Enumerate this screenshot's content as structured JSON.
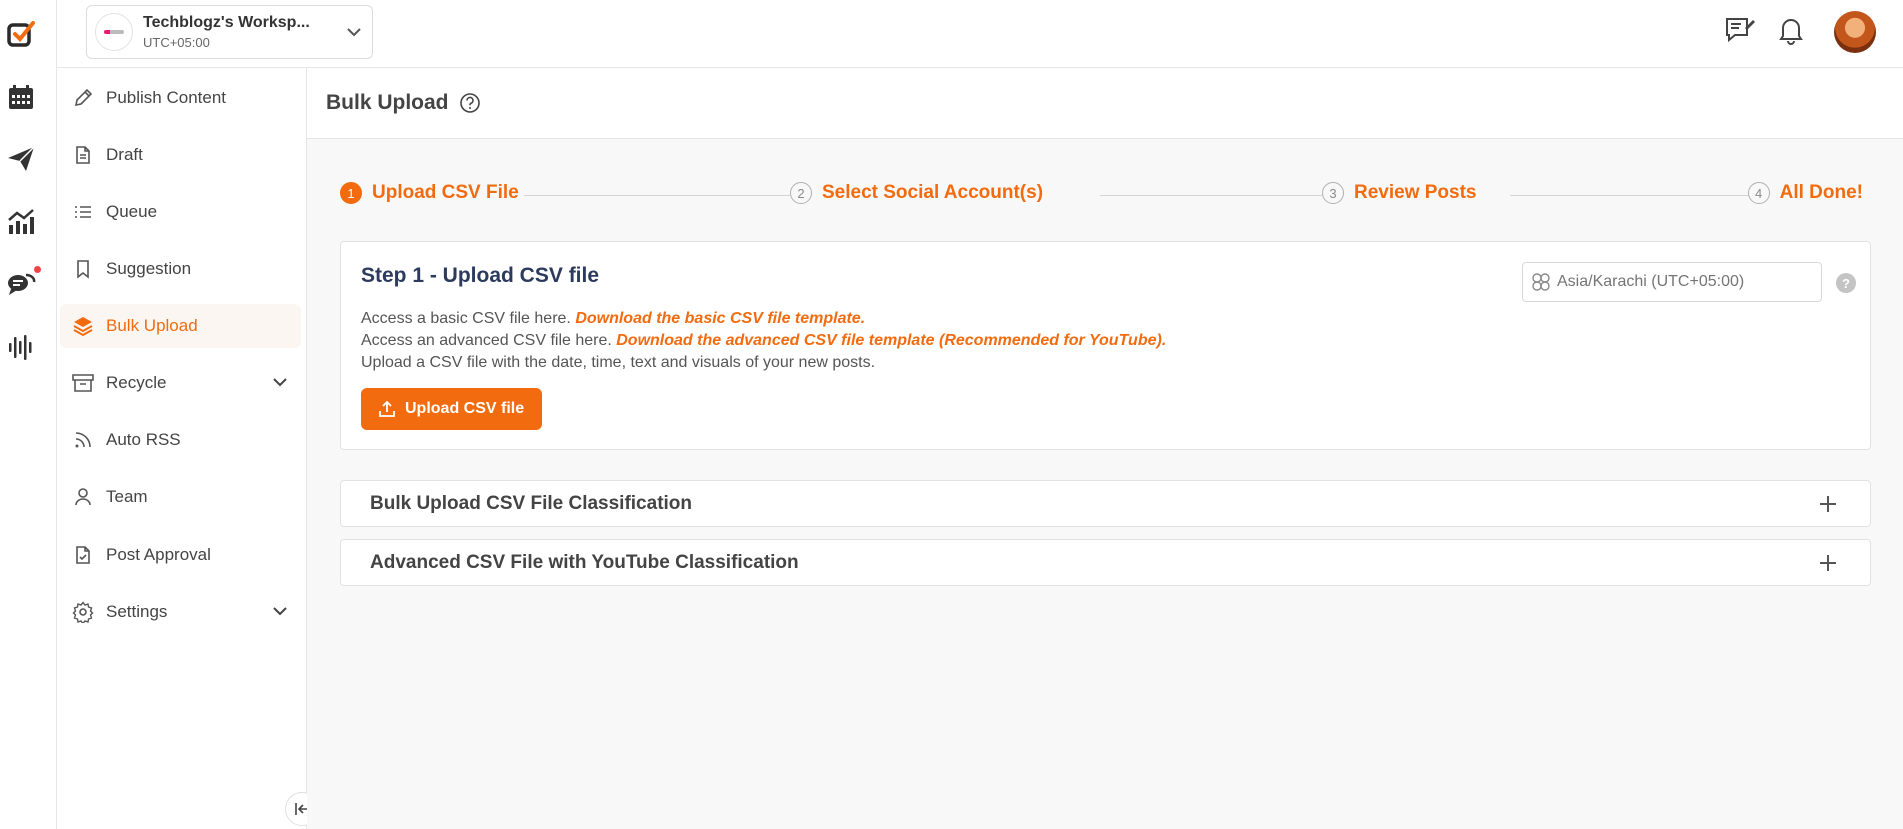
{
  "workspace": {
    "name": "Techblogz's Worksp...",
    "timezone": "UTC+05:00"
  },
  "sidebar": {
    "items": [
      {
        "label": "Publish Content",
        "icon": "pen-icon"
      },
      {
        "label": "Draft",
        "icon": "document-icon"
      },
      {
        "label": "Queue",
        "icon": "list-icon"
      },
      {
        "label": "Suggestion",
        "icon": "bookmark-icon"
      },
      {
        "label": "Bulk Upload",
        "icon": "layers-icon",
        "active": true
      },
      {
        "label": "Recycle",
        "icon": "archive-icon",
        "expandable": true
      },
      {
        "label": "Auto RSS",
        "icon": "rss-icon"
      },
      {
        "label": "Team",
        "icon": "user-icon"
      },
      {
        "label": "Post Approval",
        "icon": "file-check-icon"
      },
      {
        "label": "Settings",
        "icon": "gear-icon",
        "expandable": true
      }
    ]
  },
  "page": {
    "title": "Bulk Upload"
  },
  "stepper": {
    "steps": [
      {
        "num": "1",
        "label": "Upload CSV File",
        "active": true
      },
      {
        "num": "2",
        "label": "Select Social Account(s)"
      },
      {
        "num": "3",
        "label": "Review Posts"
      },
      {
        "num": "4",
        "label": "All Done!"
      }
    ]
  },
  "card": {
    "title": "Step 1 - Upload CSV file",
    "basic_prefix": "Access a basic CSV file here. ",
    "basic_link": "Download the basic CSV file template.",
    "advanced_prefix": "Access an advanced CSV file here. ",
    "advanced_link": "Download the advanced CSV file template (Recommended for YouTube).",
    "instruction": "Upload a CSV file with the date, time, text and visuals of your new posts.",
    "upload_button": "Upload CSV file",
    "timezone_placeholder": "Asia/Karachi (UTC+05:00)",
    "help_glyph": "?"
  },
  "accordions": [
    {
      "label": "Bulk Upload CSV File Classification"
    },
    {
      "label": "Advanced CSV File with YouTube Classification"
    }
  ],
  "colors": {
    "accent": "#f26b0f",
    "card_title": "#2c3a5e",
    "background": "#f8f8f8"
  }
}
